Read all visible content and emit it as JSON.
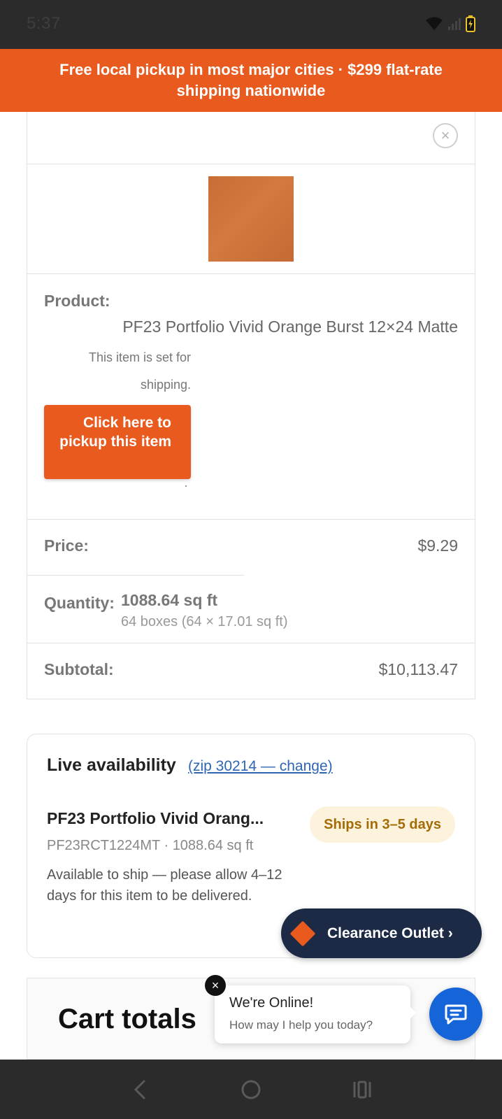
{
  "status_bar": {
    "time": "5:37",
    "icons": [
      "wifi-icon",
      "signal-icon",
      "battery-icon"
    ]
  },
  "promo": {
    "text": "Free local pickup in most major cities · $299 flat-rate shipping nationwide",
    "color": "#e85a1e"
  },
  "cart_item": {
    "product_label": "Product:",
    "product_name": "PF23 Portfolio Vivid Orange Burst 12×24 Matte",
    "ship_note": "This item is set for shipping.",
    "pickup_button": "Click here to pickup this item",
    "price_label": "Price:",
    "price": "$9.29",
    "quantity_label": "Quantity:",
    "quantity": "1088.64 sq ft",
    "quantity_boxes": "64 boxes (64 × 17.01 sq ft)",
    "subtotal_label": "Subtotal:",
    "subtotal": "$10,113.47"
  },
  "availability": {
    "title": "Live availability",
    "zip_link": "(zip 30214 — change)",
    "product": "PF23 Portfolio Vivid Orang...",
    "sku_line": "PF23RCT1224MT · 1088.64 sq ft",
    "description": "Available to ship — please allow 4–12 days for this item to be delivered.",
    "badge": "Ships in 3–5 days"
  },
  "clearance": {
    "label": "Clearance Outlet ›"
  },
  "cart_totals": {
    "title": "Cart totals"
  },
  "chat": {
    "title": "We're Online!",
    "subtitle": "How may I help you today?"
  },
  "colors": {
    "brand_orange": "#e85a1e",
    "navy": "#1c2a45",
    "chat_blue": "#1565d8",
    "link_blue": "#2f66b4"
  }
}
